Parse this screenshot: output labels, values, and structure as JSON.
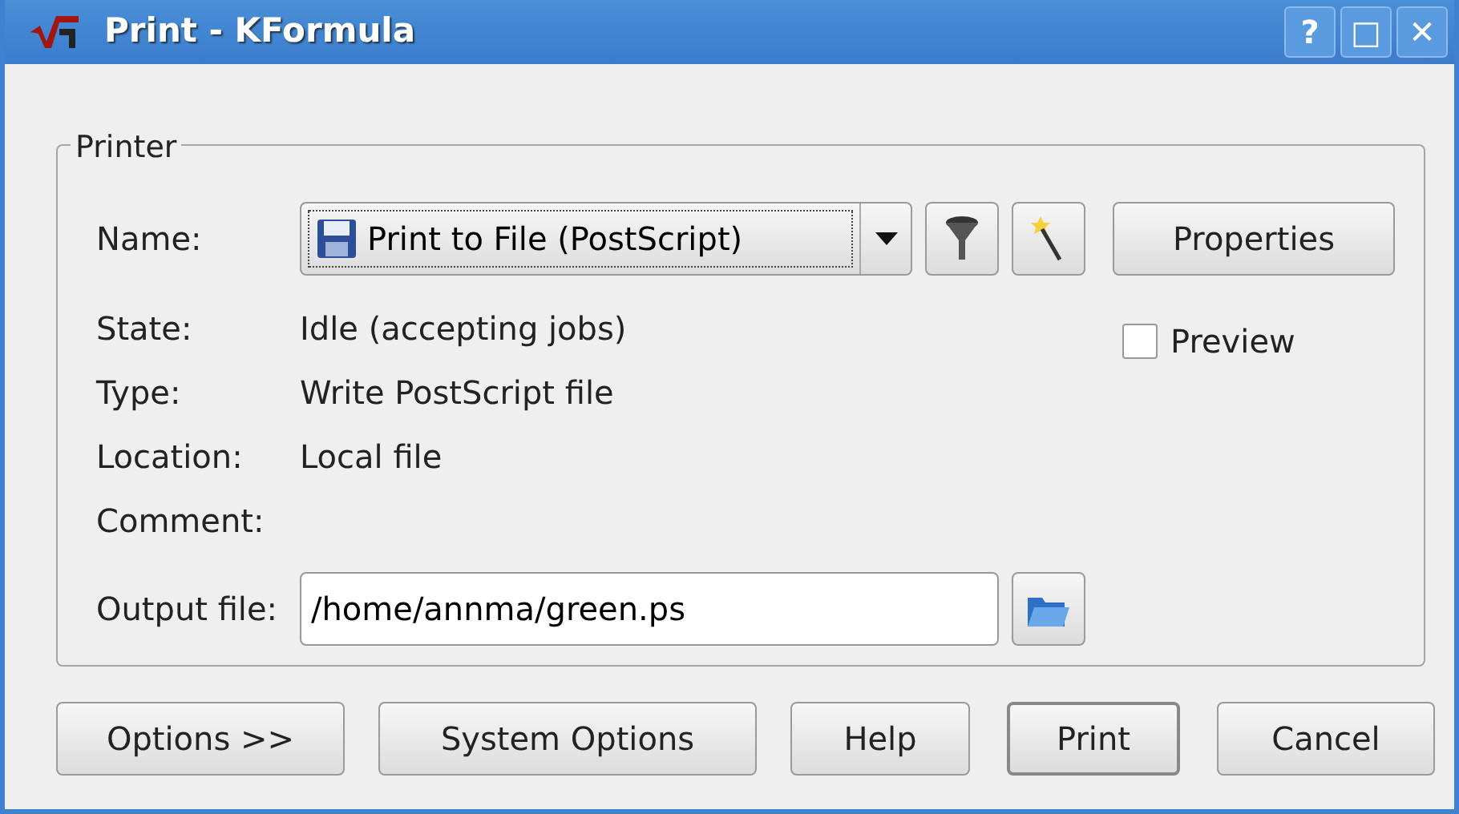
{
  "window": {
    "title": "Print - KFormula",
    "buttons": [
      "?",
      "□",
      "✕"
    ]
  },
  "printer": {
    "title": "Printer",
    "name": {
      "label": "Name:",
      "value": "Print to File (PostScript)"
    },
    "properties_button": "Properties",
    "preview": {
      "label": "Preview",
      "checked": false
    },
    "info": [
      {
        "label": "State:",
        "value": "Idle (accepting jobs)"
      },
      {
        "label": "Type:",
        "value": "Write PostScript file"
      },
      {
        "label": "Location:",
        "value": "Local file"
      },
      {
        "label": "Comment:"
      }
    ],
    "output_file": {
      "label": "Output file:",
      "value": "/home/annma/green.ps"
    }
  },
  "buttons": [
    {
      "label": "Options >>",
      "default": false
    },
    {
      "label": "System Options",
      "default": false
    },
    {
      "label": "Help",
      "default": false
    },
    {
      "label": "Print",
      "default": true
    },
    {
      "label": "Cancel",
      "default": false
    }
  ]
}
